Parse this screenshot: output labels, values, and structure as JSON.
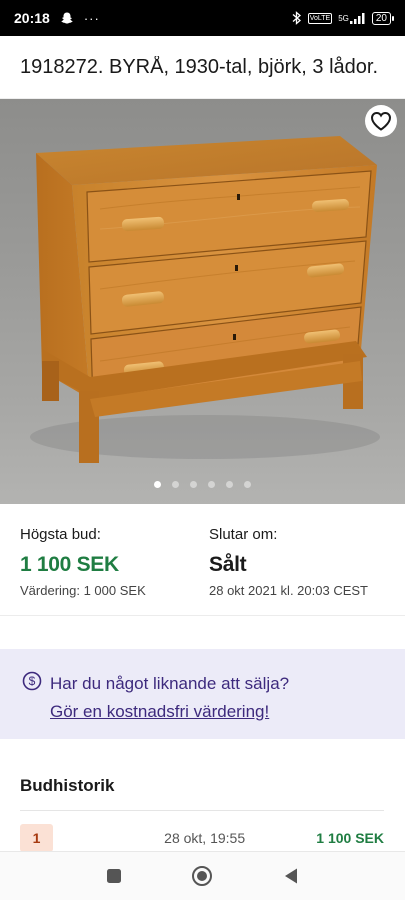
{
  "status_bar": {
    "time": "20:18",
    "notification_icons": [
      "snapchat-ghost-icon",
      "more-dots-icon"
    ],
    "dots": "···",
    "lte": "VoLTE",
    "network": "5G",
    "battery": "20"
  },
  "header": {
    "title": "1918272. BYRÅ, 1930-tal, björk, 3 lådor."
  },
  "gallery": {
    "image_description": "photo-of-birch-chest-of-drawers",
    "image_count": 6,
    "active_index": 0
  },
  "bid_info": {
    "highest_bid_label": "Högsta bud:",
    "highest_bid_value": "1 100 SEK",
    "valuation": "Värdering: 1 000 SEK",
    "ends_label": "Slutar om:",
    "ends_value": "Sålt",
    "ends_date": "28 okt 2021 kl. 20:03 CEST"
  },
  "sell_banner": {
    "question": "Har du något liknande att sälja?",
    "link": "Gör en kostnadsfri värdering!"
  },
  "bid_history": {
    "title": "Budhistorik",
    "rows": [
      {
        "number": "1",
        "time": "28 okt, 19:55",
        "amount": "1 100 SEK"
      }
    ]
  },
  "colors": {
    "accent_green": "#1f7d42",
    "banner_purple": "#3d2a7d",
    "banner_bg": "#ecebf8"
  }
}
